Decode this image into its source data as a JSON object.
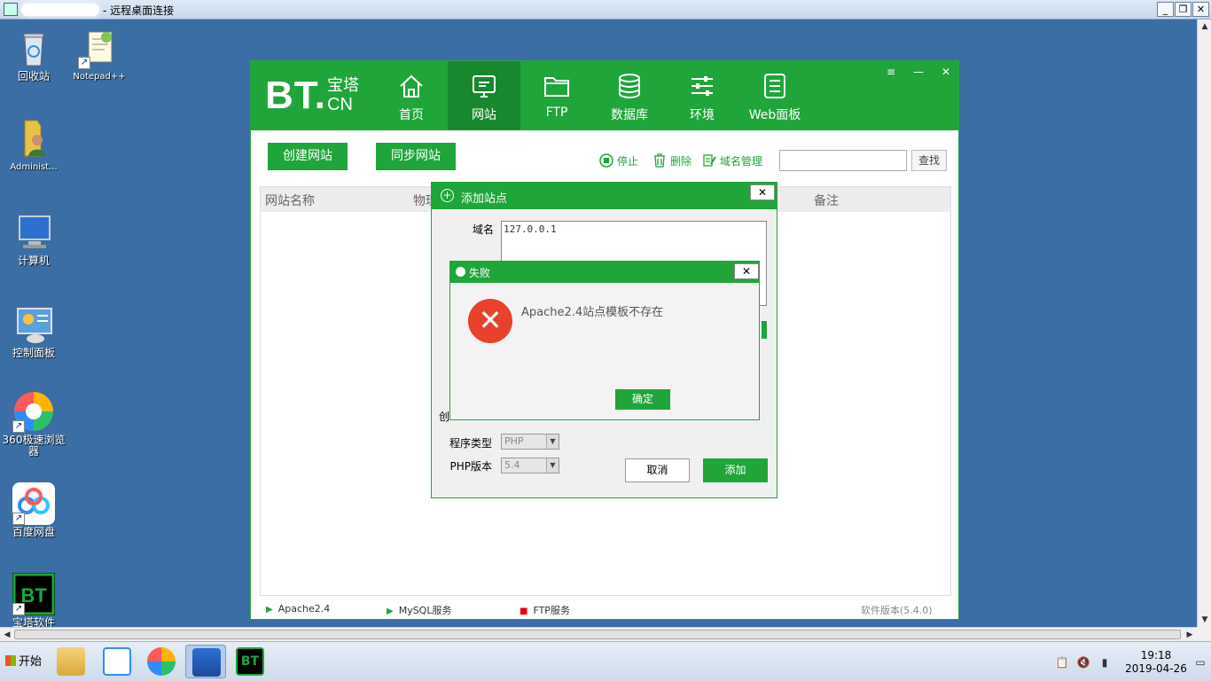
{
  "rdp": {
    "title": "- 远程桌面连接",
    "min": "_",
    "restore": "❐",
    "close": "✕"
  },
  "desktop": {
    "icons": [
      {
        "label": "回收站"
      },
      {
        "label": "Notepad++"
      },
      {
        "label": "Administ..."
      },
      {
        "label": "计算机"
      },
      {
        "label": "控制面板"
      },
      {
        "label": "360极速浏览器"
      },
      {
        "label": "百度网盘"
      },
      {
        "label": "宝塔软件"
      }
    ]
  },
  "bt": {
    "logo": {
      "main": "BT",
      "dot": ".",
      "cn_top": "宝塔",
      "cn_bottom": "CN"
    },
    "nav": [
      {
        "label": "首页",
        "icon": "home-icon"
      },
      {
        "label": "网站",
        "icon": "monitor-icon"
      },
      {
        "label": "FTP",
        "icon": "folder-icon"
      },
      {
        "label": "数据库",
        "icon": "database-icon"
      },
      {
        "label": "环境",
        "icon": "sliders-icon"
      },
      {
        "label": "Web面板",
        "icon": "list-panel-icon"
      }
    ],
    "controls": {
      "menu": "≡",
      "min": "—",
      "close": "✕"
    },
    "actions": {
      "create": "创建网站",
      "sync": "同步网站"
    },
    "tools": {
      "stop": "停止",
      "delete": "删除",
      "domain": "域名管理",
      "search_btn": "查找"
    },
    "table": {
      "col_name": "网站名称",
      "col_path": "物理",
      "col_note": "备注"
    },
    "footer": {
      "apache": "Apache2.4",
      "mysql": "MySQL服务",
      "ftp": "FTP服务",
      "version": "软件版本(5.4.0)"
    }
  },
  "addsite": {
    "title": "添加站点",
    "domain_label": "域名",
    "domain_value": "127.0.0.1",
    "create_label": "创",
    "program_label": "程序类型",
    "program_value": "PHP",
    "php_label": "PHP版本",
    "php_value": "5.4",
    "cancel": "取消",
    "add": "添加"
  },
  "error": {
    "title": "失败",
    "message": "Apache2.4站点模板不存在",
    "ok": "确定"
  },
  "taskbar": {
    "start": "开始",
    "time": "19:18",
    "date": "2019-04-26"
  }
}
